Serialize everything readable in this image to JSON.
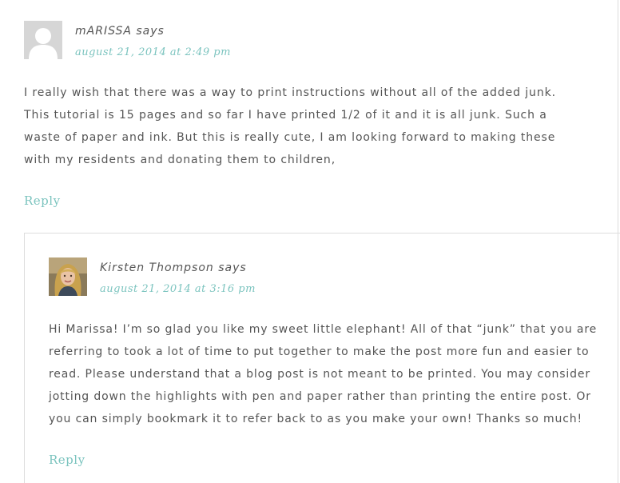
{
  "comments": [
    {
      "author": "mARISSA",
      "says": "says",
      "date": "august 21, 2014 at 2:49 pm",
      "body": "I really wish that there was a way to print instructions without all of the added junk. This tutorial is 15 pages and so far I have printed 1/2 of it and it is all junk. Such a waste of paper and ink. But this is really cute, I am looking forward to making these with my residents and donating them to children,",
      "reply": "Reply",
      "avatar": "default-user-icon"
    },
    {
      "author": "Kirsten Thompson",
      "says": "says",
      "date": "august 21, 2014 at 3:16 pm",
      "body": "Hi Marissa! I’m so glad you like my sweet little elephant! All of that “junk” that you are referring to took a lot of time to put together to make the post more fun and easier to read. Please understand that a blog post is not meant to be printed. You may consider jotting down the highlights with pen and paper rather than printing the entire post. Or you can simply bookmark it to refer back to as you make your own! Thanks so much!",
      "reply": "Reply",
      "avatar": "user-photo"
    }
  ],
  "colors": {
    "accent": "#7cc4bf",
    "text": "#555555",
    "border": "#dddddd",
    "avatar_bg": "#d6d6d6"
  }
}
